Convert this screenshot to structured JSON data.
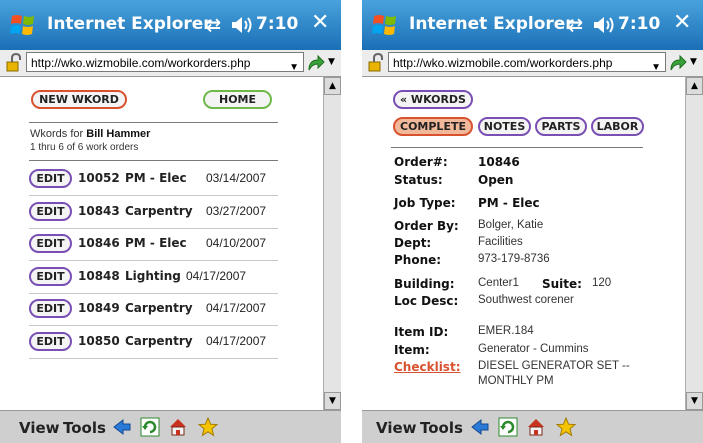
{
  "left": {
    "titlebar": {
      "title": "Internet Explorer",
      "time": "7:10",
      "close": "✕"
    },
    "address": {
      "url": "http://wko.wizmobile.com/workorders.php"
    },
    "buttons": {
      "new": "NEW WKORD",
      "home": "HOME"
    },
    "wkords_for_prefix": "Wkords for",
    "user": "Bill Hammer",
    "range": "1 thru 6  of 6 work orders",
    "edit_label": "EDIT",
    "rows": [
      {
        "num": "10052",
        "type": "PM - Elec",
        "date": "03/14/2007"
      },
      {
        "num": "10843",
        "type": "Carpentry",
        "date": "03/27/2007"
      },
      {
        "num": "10846",
        "type": "PM - Elec",
        "date": "04/10/2007"
      },
      {
        "num": "10848",
        "type": "Lighting",
        "date": "04/17/2007"
      },
      {
        "num": "10849",
        "type": "Carpentry",
        "date": "04/17/2007"
      },
      {
        "num": "10850",
        "type": "Carpentry",
        "date": "04/17/2007"
      }
    ],
    "menu": {
      "view": "View",
      "tools": "Tools"
    }
  },
  "right": {
    "titlebar": {
      "title": "Internet Explorer",
      "time": "7:10",
      "close": "✕"
    },
    "address": {
      "url": "http://wko.wizmobile.com/workorders.php"
    },
    "back_button": "« WKORDS",
    "tabs": {
      "complete": "COMPLETE",
      "notes": "NOTES",
      "parts": "PARTS",
      "labor": "LABOR"
    },
    "fields": {
      "order_label": "Order#:",
      "order": "10846",
      "status_label": "Status:",
      "status": "Open",
      "jobtype_label": "Job Type:",
      "jobtype": "PM - Elec",
      "orderby_label": "Order By:",
      "orderby": "Bolger, Katie",
      "dept_label": "Dept:",
      "dept": "Facilities",
      "phone_label": "Phone:",
      "phone": "973-179-8736",
      "building_label": "Building:",
      "building": "Center1",
      "suite_label": "Suite:",
      "suite": "120",
      "locdesc_label": "Loc Desc:",
      "locdesc": "Southwest corener",
      "itemid_label": "Item ID:",
      "itemid": "EMER.184",
      "item_label": "Item:",
      "item": "Generator - Cummins",
      "checklist_label": "Checklist:",
      "checklist_line1": "DIESEL GENERATOR SET --",
      "checklist_line2": "MONTHLY PM"
    },
    "menu": {
      "view": "View",
      "tools": "Tools"
    }
  },
  "colors": {
    "titlebar": "#1a6fb6",
    "orange": "#d9522f",
    "green": "#6fb94a",
    "purple": "#7a4fb4"
  }
}
